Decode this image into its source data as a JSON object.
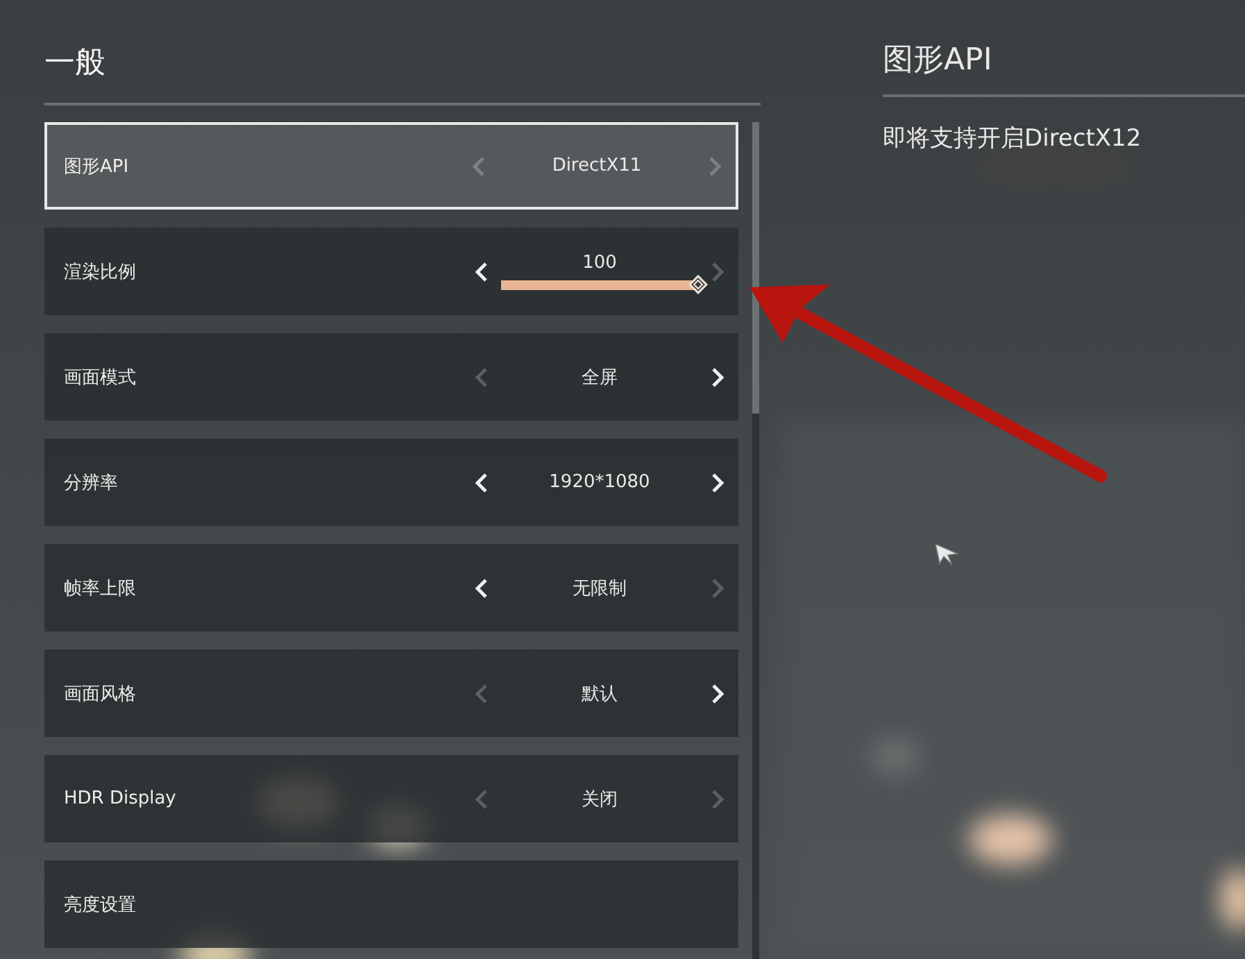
{
  "section_title": "一般",
  "settings": [
    {
      "kind": "selector",
      "label": "图形API",
      "value": "DirectX11",
      "selected": true,
      "prev_enabled": false,
      "next_enabled": false
    },
    {
      "kind": "slider",
      "label": "渲染比例",
      "value": "100",
      "selected": false,
      "prev_enabled": true,
      "next_enabled": false,
      "level": 1
    },
    {
      "kind": "selector",
      "label": "画面模式",
      "value": "全屏",
      "selected": false,
      "prev_enabled": false,
      "next_enabled": true
    },
    {
      "kind": "selector",
      "label": "分辨率",
      "value": "1920*1080",
      "selected": false,
      "prev_enabled": true,
      "next_enabled": true
    },
    {
      "kind": "selector",
      "label": "帧率上限",
      "value": "无限制",
      "selected": false,
      "prev_enabled": true,
      "next_enabled": false
    },
    {
      "kind": "selector",
      "label": "画面风格",
      "value": "默认",
      "selected": false,
      "prev_enabled": false,
      "next_enabled": true
    },
    {
      "kind": "selector",
      "label": "HDR Display",
      "value": "关闭",
      "selected": false,
      "prev_enabled": false,
      "next_enabled": false
    },
    {
      "kind": "link",
      "label": "亮度设置",
      "selected": false
    }
  ],
  "detail": {
    "title": "图形API",
    "description": "即将支持开启DirectX12"
  }
}
